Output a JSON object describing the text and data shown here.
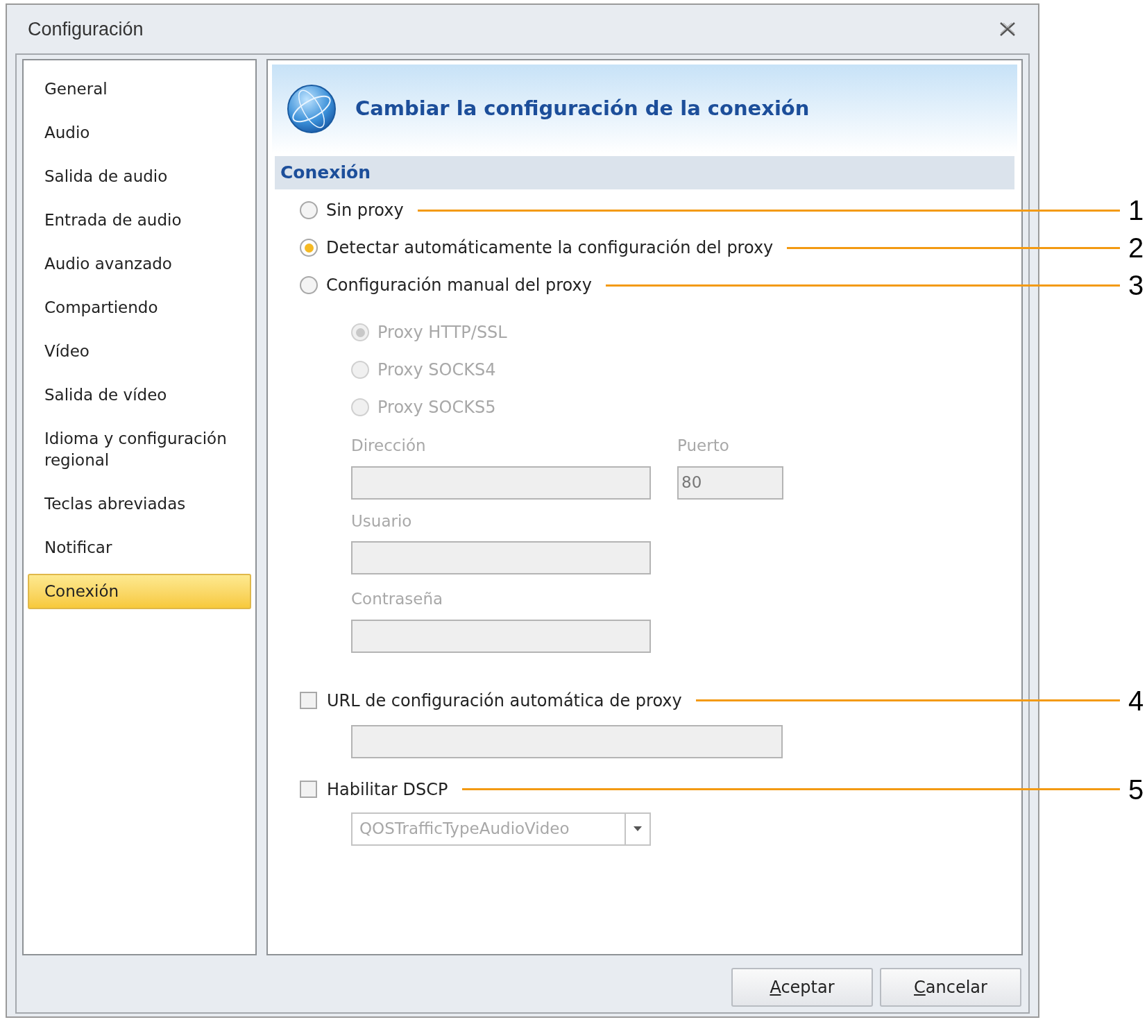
{
  "window": {
    "title": "Configuración"
  },
  "sidebar": {
    "items": [
      {
        "label": "General",
        "selected": false
      },
      {
        "label": "Audio",
        "selected": false
      },
      {
        "label": "Salida de audio",
        "selected": false
      },
      {
        "label": "Entrada de audio",
        "selected": false
      },
      {
        "label": "Audio avanzado",
        "selected": false
      },
      {
        "label": "Compartiendo",
        "selected": false
      },
      {
        "label": "Vídeo",
        "selected": false
      },
      {
        "label": "Salida de vídeo",
        "selected": false
      },
      {
        "label": "Idioma y configuración regional",
        "selected": false
      },
      {
        "label": "Teclas abreviadas",
        "selected": false
      },
      {
        "label": "Notificar",
        "selected": false
      },
      {
        "label": "Conexión",
        "selected": true
      }
    ]
  },
  "header": {
    "title": "Cambiar la configuración de la conexión"
  },
  "section": {
    "title": "Conexión"
  },
  "proxy_options": [
    {
      "label": "Sin proxy",
      "selected": false,
      "callout": "1"
    },
    {
      "label": "Detectar automáticamente la configuración del proxy",
      "selected": true,
      "callout": "2"
    },
    {
      "label": "Configuración manual del proxy",
      "selected": false,
      "callout": "3"
    }
  ],
  "proxy_types": [
    {
      "label": "Proxy HTTP/SSL",
      "selected": true,
      "disabled": true
    },
    {
      "label": "Proxy SOCKS4",
      "selected": false,
      "disabled": true
    },
    {
      "label": "Proxy SOCKS5",
      "selected": false,
      "disabled": true
    }
  ],
  "address": {
    "label": "Dirección"
  },
  "port": {
    "label": "Puerto",
    "value": "80"
  },
  "user": {
    "label": "Usuario"
  },
  "password": {
    "label": "Contraseña"
  },
  "auto_config_url": {
    "label": "URL de configuración automática de proxy",
    "checked": false,
    "callout": "4"
  },
  "dscp": {
    "label": "Habilitar DSCP",
    "checked": false,
    "callout": "5",
    "value": "QOSTrafficTypeAudioVideo"
  },
  "buttons": [
    {
      "mnemonic": "A",
      "rest": "ceptar"
    },
    {
      "mnemonic": "C",
      "rest": "ancelar"
    }
  ]
}
